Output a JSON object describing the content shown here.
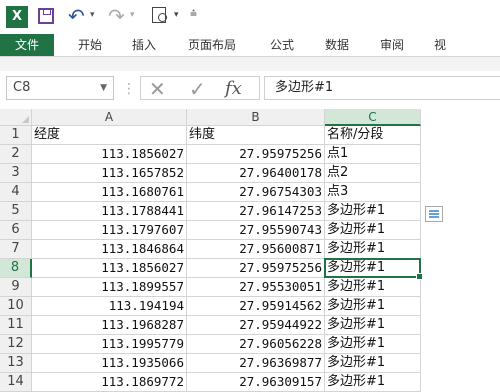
{
  "app_icon": "X",
  "ribbon": {
    "tabs": [
      "文件",
      "开始",
      "插入",
      "页面布局",
      "公式",
      "数据",
      "审阅",
      "视"
    ]
  },
  "formula_bar": {
    "name_box": "C8",
    "formula": "多边形#1"
  },
  "sheet": {
    "columns": [
      "A",
      "B",
      "C"
    ],
    "selected_column": "C",
    "selected_row": "8",
    "rows": [
      {
        "n": "1",
        "a": "经度",
        "b": "纬度",
        "c": "名称/分段"
      },
      {
        "n": "2",
        "a": "113.1856027",
        "b": "27.95975256",
        "c": "点1"
      },
      {
        "n": "3",
        "a": "113.1657852",
        "b": "27.96400178",
        "c": "点2"
      },
      {
        "n": "4",
        "a": "113.1680761",
        "b": "27.96754303",
        "c": "点3"
      },
      {
        "n": "5",
        "a": "113.1788441",
        "b": "27.96147253",
        "c": "多边形#1"
      },
      {
        "n": "6",
        "a": "113.1797607",
        "b": "27.95590743",
        "c": "多边形#1"
      },
      {
        "n": "7",
        "a": "113.1846864",
        "b": "27.95600871",
        "c": "多边形#1"
      },
      {
        "n": "8",
        "a": "113.1856027",
        "b": "27.95975256",
        "c": "多边形#1"
      },
      {
        "n": "9",
        "a": "113.1899557",
        "b": "27.95530051",
        "c": "多边形#1"
      },
      {
        "n": "10",
        "a": "113.194194",
        "b": "27.95914562",
        "c": "多边形#1"
      },
      {
        "n": "11",
        "a": "113.1968287",
        "b": "27.95944922",
        "c": "多边形#1"
      },
      {
        "n": "12",
        "a": "113.1995779",
        "b": "27.96056228",
        "c": "多边形#1"
      },
      {
        "n": "13",
        "a": "113.1935066",
        "b": "27.96369877",
        "c": "多边形#1"
      },
      {
        "n": "14",
        "a": "113.1869772",
        "b": "27.96309157",
        "c": "多边形#1"
      }
    ]
  },
  "colors": {
    "accent": "#217346",
    "header_bg": "#f0f0f0",
    "grid_line": "#d4d4d4"
  }
}
